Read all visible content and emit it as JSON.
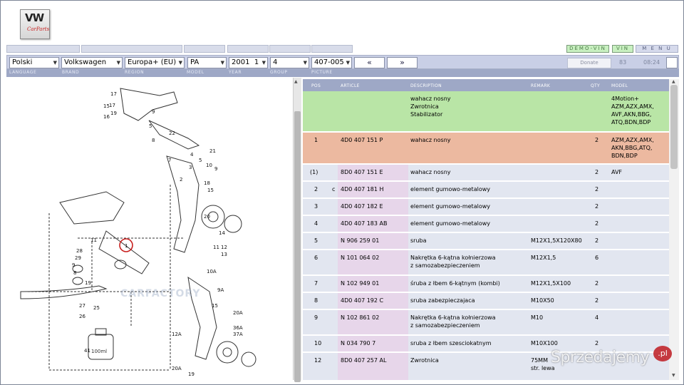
{
  "logo": {
    "text": "VW",
    "subtext": "CarParts"
  },
  "top_buttons": {
    "demo_vin": "DEMO-VIN",
    "vin": "VIN",
    "menu": "M E N U"
  },
  "selectors": {
    "language": "Polski",
    "brand": "Volkswagen",
    "region": "Europa+ (EU)",
    "model": "PA",
    "year": "2001",
    "year_sub": "1",
    "group": "4",
    "picture": "407-005"
  },
  "nav": {
    "prev": "«",
    "next": "»",
    "donate": "Donate",
    "count": "83",
    "time": "08:24"
  },
  "labels": {
    "language": "LANGUAGE",
    "brand": "BRAND",
    "region": "REGION",
    "model": "MODEL",
    "year": "YEAR",
    "group": "GROUP",
    "picture": "PICTURE"
  },
  "diagram": {
    "callouts": [
      "17",
      "15",
      "16",
      "17",
      "19",
      "9",
      "8",
      "7",
      "4",
      "5",
      "3",
      "2",
      "22",
      "18",
      "20",
      "21",
      "10",
      "9",
      "5",
      "15",
      "11",
      "12",
      "13",
      "14",
      "28",
      "29",
      "9",
      "8",
      "19",
      "11",
      "1",
      "25",
      "27",
      "26",
      "10A",
      "9A",
      "15",
      "20A",
      "36A",
      "12A",
      "37A",
      "41",
      "20A",
      "19"
    ],
    "oil_label": "100ml",
    "watermark": "CARFACTORY"
  },
  "table": {
    "headers": {
      "pos": "POS",
      "article": "ARTICLE",
      "description": "DESCRIPTION",
      "remark": "REMARK",
      "qty": "QTY",
      "model": "MODEL"
    },
    "rows": [
      {
        "pos": "",
        "flag": "",
        "article": "",
        "description": "wahacz nosny\nZwrotnica\nStabilizator",
        "remark": "",
        "qty": "",
        "model": "4Motion+\nAZM,AZX,AMX,\nAVF,AKN,BBG,\nATQ,BDN,BDP",
        "bg": "#b9e5a6",
        "artbg": "#b9e5a6"
      },
      {
        "pos": "1",
        "flag": "",
        "article": "4D0 407 151 P",
        "description": "wahacz nosny",
        "remark": "",
        "qty": "2",
        "model": "AZM,AZX,AMX,\nAKN,BBG,ATQ,\nBDN,BDP",
        "bg": "#ecb9a0",
        "artbg": "#ecb9a0"
      },
      {
        "pos": "(1)",
        "flag": "",
        "article": "8D0 407 151 E",
        "description": "wahacz nosny",
        "remark": "",
        "qty": "2",
        "model": "AVF",
        "bg": "#e2e6f0",
        "artbg": "#e7d6ea"
      },
      {
        "pos": "2",
        "flag": "c",
        "article": "4D0 407 181 H",
        "description": "element gumowo-metalowy",
        "remark": "",
        "qty": "2",
        "model": "",
        "bg": "#e2e6f0",
        "artbg": "#e7d6ea"
      },
      {
        "pos": "3",
        "flag": "",
        "article": "4D0 407 182 E",
        "description": "element gumowo-metalowy",
        "remark": "",
        "qty": "2",
        "model": "",
        "bg": "#e2e6f0",
        "artbg": "#e7d6ea"
      },
      {
        "pos": "4",
        "flag": "",
        "article": "4D0 407 183 AB",
        "description": "element gumowo-metalowy",
        "remark": "",
        "qty": "2",
        "model": "",
        "bg": "#e2e6f0",
        "artbg": "#e7d6ea"
      },
      {
        "pos": "5",
        "flag": "",
        "article": "N   906 259 01",
        "description": "sruba",
        "remark": "M12X1,5X120X80",
        "qty": "2",
        "model": "",
        "bg": "#e2e6f0",
        "artbg": "#e7d6ea"
      },
      {
        "pos": "6",
        "flag": "",
        "article": "N   101 064 02",
        "description": "Nakrętka 6-kątna kołnierzowa\nz samozabezpieczeniem",
        "remark": "M12X1,5",
        "qty": "6",
        "model": "",
        "bg": "#e2e6f0",
        "artbg": "#e7d6ea"
      },
      {
        "pos": "7",
        "flag": "",
        "article": "N   102 949 01",
        "description": "śruba z łbem 6-kątnym (kombi)",
        "remark": "M12X1,5X100",
        "qty": "2",
        "model": "",
        "bg": "#e2e6f0",
        "artbg": "#e7d6ea"
      },
      {
        "pos": "8",
        "flag": "",
        "article": "4D0 407 192 C",
        "description": "sruba zabezpieczajaca",
        "remark": "M10X50",
        "qty": "2",
        "model": "",
        "bg": "#e2e6f0",
        "artbg": "#e7d6ea"
      },
      {
        "pos": "9",
        "flag": "",
        "article": "N   102 861 02",
        "description": "Nakrętka 6-kątna kołnierzowa\nz samozabezpieczeniem",
        "remark": "M10",
        "qty": "4",
        "model": "",
        "bg": "#e2e6f0",
        "artbg": "#e7d6ea"
      },
      {
        "pos": "10",
        "flag": "",
        "article": "N   034 790 7",
        "description": "sruba  z łbem szesciokatnym",
        "remark": "M10X100",
        "qty": "2",
        "model": "",
        "bg": "#e2e6f0",
        "artbg": "#e7d6ea"
      },
      {
        "pos": "12",
        "flag": "",
        "article": "8D0 407 257 AL",
        "description": "Zwrotnica",
        "remark": "75MM\nstr. lewa",
        "qty": "",
        "model": "",
        "bg": "#e2e6f0",
        "artbg": "#e7d6ea"
      }
    ]
  },
  "watermark": {
    "text": "Sprzedajemy",
    "badge": ".pl"
  }
}
